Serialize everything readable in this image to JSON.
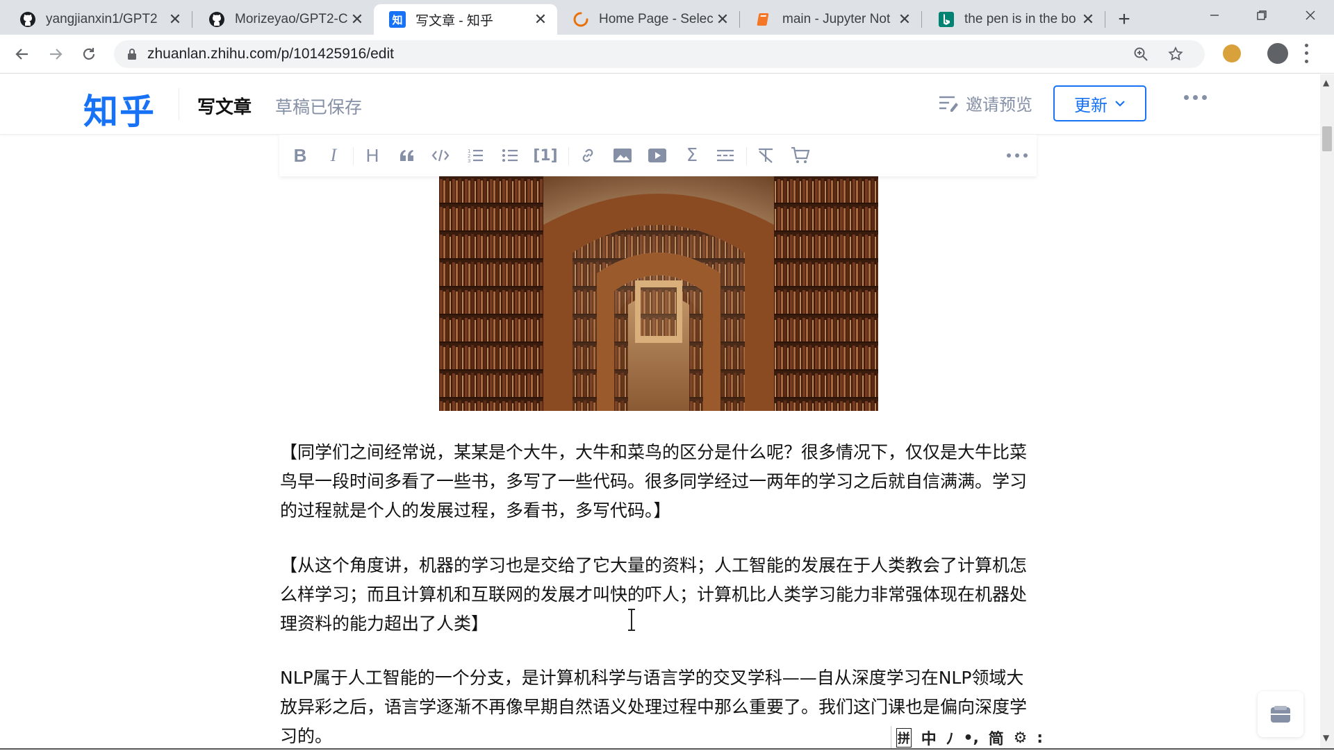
{
  "browser": {
    "tabs": [
      {
        "title": "yangjianxin1/GPT2",
        "favicon": "github-icon",
        "active": false
      },
      {
        "title": "Morizeyao/GPT2-C",
        "favicon": "github-icon",
        "active": false
      },
      {
        "title": "写文章 - 知乎",
        "favicon": "zhihu-icon",
        "favicon_text": "知",
        "active": true
      },
      {
        "title": "Home Page - Selec",
        "favicon": "loading-spinner-icon",
        "active": false
      },
      {
        "title": "main - Jupyter Not",
        "favicon": "notebook-icon",
        "active": false
      },
      {
        "title": "the pen is in the bo",
        "favicon": "bing-icon",
        "active": false
      }
    ],
    "new_tab_label": "+",
    "url": "zhuanlan.zhihu.com/p/101425916/edit"
  },
  "header": {
    "logo": "知乎",
    "page_title": "写文章",
    "save_status": "草稿已保存",
    "preview_label": "邀请预览",
    "update_label": "更新"
  },
  "editor_toolbar": {
    "buttons": [
      "bold-icon",
      "italic-icon",
      "heading-icon",
      "quote-icon",
      "code-icon",
      "ordered-list-icon",
      "bullet-list-icon",
      "reference-icon",
      "link-icon",
      "image-icon",
      "video-icon",
      "formula-icon",
      "divider-icon",
      "clear-format-icon",
      "shopping-cart-icon",
      "more-icon"
    ],
    "reference_label": "[1]"
  },
  "article": {
    "cover_image_alt": "library-bookshelves-arches",
    "paragraphs": [
      "【同学们之间经常说，某某是个大牛，大牛和菜鸟的区分是什么呢？很多情况下，仅仅是大牛比菜鸟早一段时间多看了一些书，多写了一些代码。很多同学经过一两年的学习之后就自信满满。学习的过程就是个人的发展过程，多看书，多写代码。】",
      "【从这个角度讲，机器的学习也是交给了它大量的资料；人工智能的发展在于人类教会了计算机怎么样学习；而且计算机和互联网的发展才叫快的吓人；计算机比人类学习能力非常强体现在机器处理资料的能力超出了人类】",
      "NLP属于人工智能的一个分支，是计算机科学与语言学的交叉学科——自从深度学习在NLP领域大放异彩之后，语言学逐渐不再像早期自然语义处理过程中那么重要了。我们这门课也是偏向深度学习的。"
    ]
  },
  "ime": {
    "items": [
      "拼",
      "中",
      "ﾉ",
      "•,",
      "简",
      "⚙",
      ":"
    ]
  },
  "colors": {
    "zhihu_blue": "#1772f6",
    "muted_gray": "#8590a6",
    "tabstrip_bg": "#dee1e6"
  }
}
